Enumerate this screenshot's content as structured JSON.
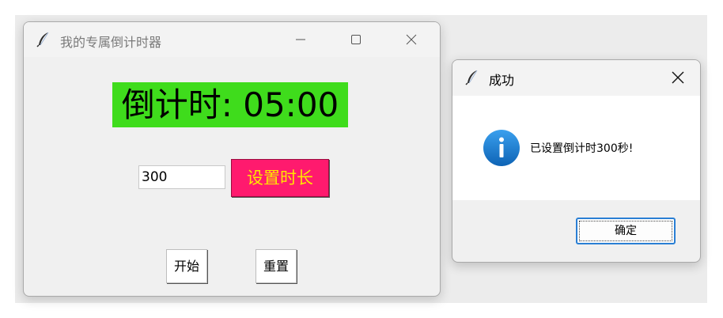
{
  "main_window": {
    "title": "我的专属倒计时器",
    "timer_label": "倒计时: 05:00",
    "duration_input_value": "300",
    "set_duration_label": "设置时长",
    "start_label": "开始",
    "reset_label": "重置"
  },
  "dialog": {
    "title": "成功",
    "message": "已设置倒计时300秒!",
    "ok_label": "确定"
  },
  "colors": {
    "timer_bg": "#3fdc1c",
    "set_button_bg": "#ff1a6e",
    "set_button_text": "#ffe600",
    "info_icon": "#1a73c8"
  },
  "icons": {
    "app": "feather-icon",
    "minimize": "minimize-icon",
    "maximize": "maximize-icon",
    "close": "close-icon",
    "info": "info-icon"
  }
}
